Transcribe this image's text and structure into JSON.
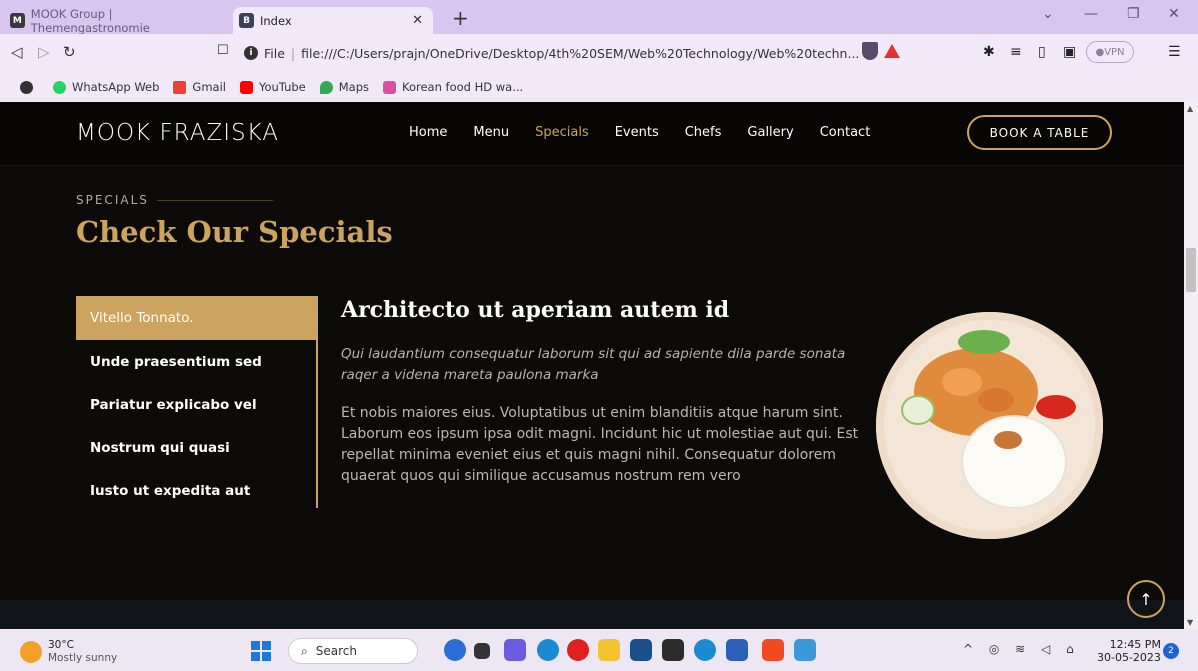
{
  "browser": {
    "tabs": [
      {
        "title": "MOOK Group | Themengastronomie"
      },
      {
        "title": "Index"
      }
    ],
    "url_prefix": "File",
    "url": "file:///C:/Users/prajn/OneDrive/Desktop/4th%20SEM/Web%20Technology/Web%20techn...",
    "vpn_label": "VPN",
    "bookmarks": [
      {
        "label": "WhatsApp Web",
        "color": "#25d366"
      },
      {
        "label": "Gmail",
        "color": "#ea4335"
      },
      {
        "label": "YouTube",
        "color": "#ff0000"
      },
      {
        "label": "Maps",
        "color": "#34a853"
      },
      {
        "label": "Korean food HD wa...",
        "color": "#d94fa0"
      }
    ]
  },
  "site": {
    "logo": "MOOK FRAZISKA",
    "nav": [
      "Home",
      "Menu",
      "Specials",
      "Events",
      "Chefs",
      "Gallery",
      "Contact"
    ],
    "active_nav": "Specials",
    "book_button": "BOOK A TABLE",
    "accent_color": "#cda45e"
  },
  "specials": {
    "label": "SPECIALS",
    "title": "Check Our Specials",
    "items": [
      "Vitello Tonnato.",
      "Unde praesentium sed",
      "Pariatur explicabo vel",
      "Nostrum qui quasi",
      "Iusto ut expedita aut"
    ],
    "active_item": "Vitello Tonnato.",
    "detail": {
      "title": "Architecto ut aperiam autem id",
      "italic": "Qui laudantium consequatur laborum sit qui ad sapiente dila parde sonata raqer a videna mareta paulona marka",
      "body": "Et nobis maiores eius. Voluptatibus ut enim blanditiis atque harum sint. Laborum eos ipsum ipsa odit magni. Incidunt hic ut molestiae aut qui. Est repellat minima eveniet eius et quis magni nihil. Consequatur dolorem quaerat quos qui similique accusamus nostrum rem vero"
    }
  },
  "taskbar": {
    "temperature": "30°C",
    "weather": "Mostly sunny",
    "search_placeholder": "Search",
    "time": "12:45 PM",
    "date": "30-05-2023",
    "notifications": "2"
  }
}
